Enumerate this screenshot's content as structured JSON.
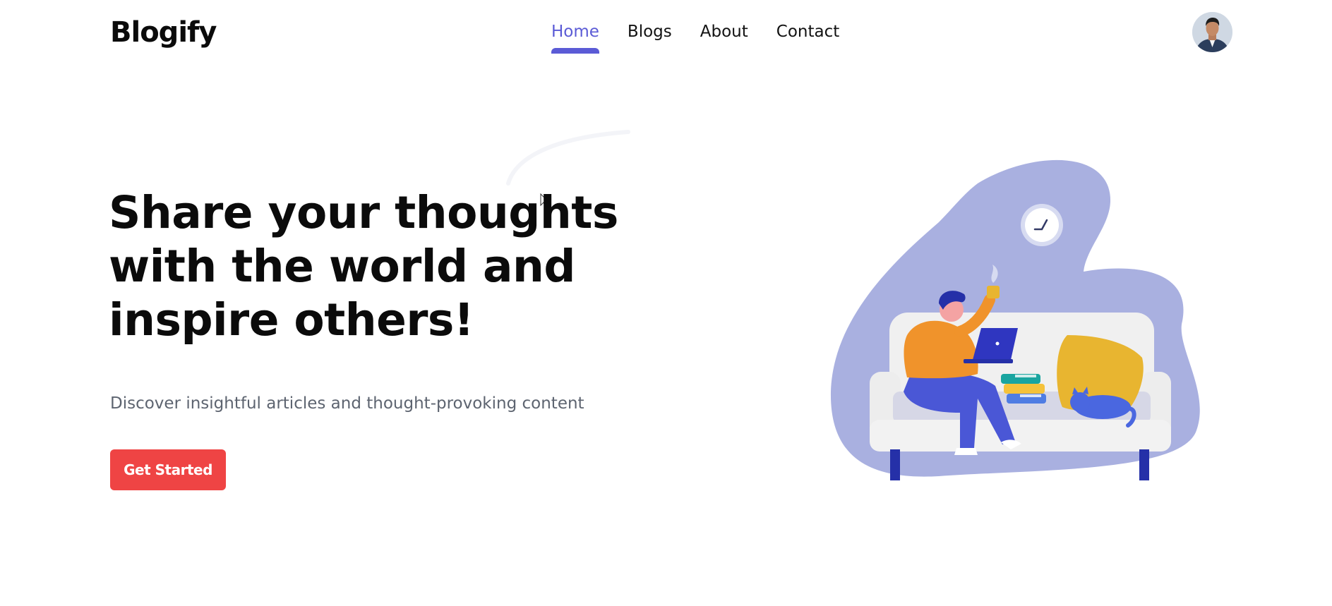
{
  "brand": {
    "name": "Blogify"
  },
  "nav": {
    "items": [
      {
        "label": "Home",
        "active": true
      },
      {
        "label": "Blogs",
        "active": false
      },
      {
        "label": "About",
        "active": false
      },
      {
        "label": "Contact",
        "active": false
      }
    ],
    "accent_color": "#5b5bd6"
  },
  "hero": {
    "title": "Share your thoughts with the world and inspire others!",
    "subtitle": "Discover insightful articles and thought-provoking content",
    "cta_label": "Get Started",
    "cta_color": "#ef4444"
  },
  "illustration": {
    "icon": "person-reading-on-sofa-illustration",
    "blob_color": "#a9b0e0"
  },
  "user": {
    "avatar_icon": "user-avatar-icon"
  }
}
